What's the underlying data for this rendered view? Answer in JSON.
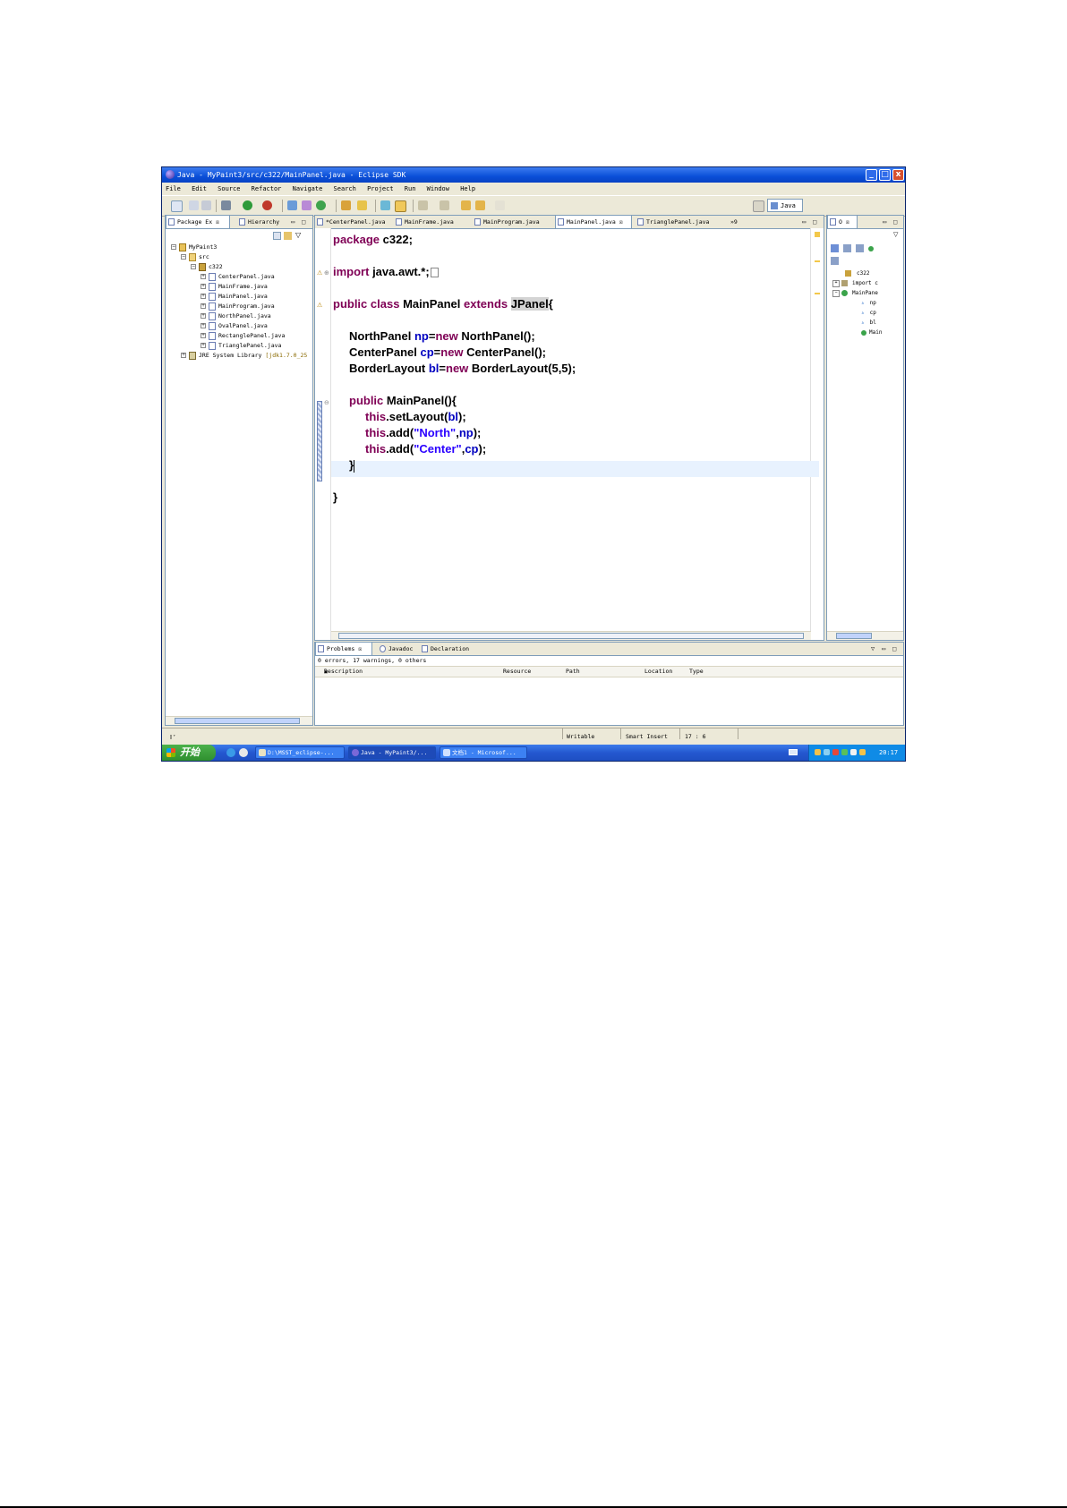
{
  "window": {
    "title": "Java - MyPaint3/src/c322/MainPanel.java - Eclipse SDK",
    "controls": {
      "minimize": "_",
      "maximize": "□",
      "close": "x"
    }
  },
  "menu": [
    "File",
    "Edit",
    "Source",
    "Refactor",
    "Navigate",
    "Search",
    "Project",
    "Run",
    "Window",
    "Help"
  ],
  "perspective": {
    "label": "Java"
  },
  "package_explorer": {
    "tabs": [
      "Package Ex",
      "Hierarchy"
    ],
    "tree": {
      "project": "MyPaint3",
      "src": "src",
      "package": "c322",
      "files": [
        "CenterPanel.java",
        "MainFrame.java",
        "MainPanel.java",
        "MainProgram.java",
        "NorthPanel.java",
        "OvalPanel.java",
        "RectanglePanel.java",
        "TrianglePanel.java"
      ],
      "library": "JRE System Library",
      "library_suffix": "[jdk1.7.0_25"
    }
  },
  "editor": {
    "tabs": [
      "*CenterPanel.java",
      "MainFrame.java",
      "MainProgram.java",
      "MainPanel.java",
      "TrianglePanel.java"
    ],
    "overflow": "»9",
    "code": {
      "l1_kw": "package",
      "l1_rest": " c322;",
      "l2_kw": "import",
      "l2_rest": " java.awt.*;",
      "l3_kw1": "public",
      "l3_kw2": "class",
      "l3_name": "MainPanel",
      "l3_kw3": "extends",
      "l3_super": "JPanel",
      "l3_brace": "{",
      "l4_type": "NorthPanel ",
      "l4_var": "np",
      "l4_eq": "=",
      "l4_new": "new",
      "l4_rest": " NorthPanel();",
      "l5_type": "CenterPanel ",
      "l5_var": "cp",
      "l5_eq": "=",
      "l5_new": "new",
      "l5_rest": " CenterPanel();",
      "l6_type": "BorderLayout ",
      "l6_var": "bl",
      "l6_eq": "=",
      "l6_new": "new",
      "l6_rest": " BorderLayout(5,5);",
      "l7_kw": "public",
      "l7_rest": " MainPanel(){",
      "l8_this": "this",
      "l8_call": ".setLayout(",
      "l8_var": "bl",
      "l8_end": ");",
      "l9_this": "this",
      "l9_call": ".add(",
      "l9_str": "\"North\"",
      "l9_comma": ",",
      "l9_var": "np",
      "l9_end": ");",
      "l10_this": "this",
      "l10_call": ".add(",
      "l10_str": "\"Center\"",
      "l10_comma": ",",
      "l10_var": "cp",
      "l10_end": ");",
      "l11": "}",
      "l12": "}"
    }
  },
  "outline": {
    "tab": "O",
    "items": [
      "c322",
      "import c",
      "MainPane",
      "np",
      "cp",
      "bl",
      "Main"
    ]
  },
  "problems": {
    "tabs": [
      "Problems",
      "Javadoc",
      "Declaration"
    ],
    "summary": "0 errors, 17 warnings, 0 others",
    "columns": [
      "Description",
      "Resource",
      "Path",
      "Location",
      "Type"
    ]
  },
  "status": {
    "writable": "Writable",
    "insert_mode": "Smart Insert",
    "position": "17 : 6"
  },
  "taskbar": {
    "start": "开始",
    "tasks": [
      "D:\\MSST_eclipse-...",
      "Java - MyPaint3/...",
      "文档1 - Microsof..."
    ],
    "clock": "20:17"
  }
}
